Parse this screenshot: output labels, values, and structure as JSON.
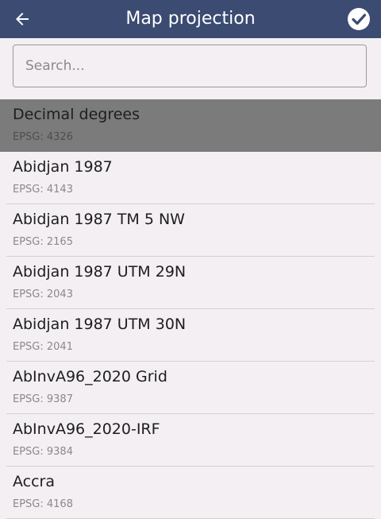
{
  "header": {
    "title": "Map projection",
    "bg_color": "#3b4b72",
    "back_icon": "arrow-left-icon",
    "confirm_icon": "check-circle-icon"
  },
  "search": {
    "placeholder": "Search...",
    "value": ""
  },
  "projections": [
    {
      "name": "Decimal degrees",
      "code": "EPSG: 4326",
      "selected": true
    },
    {
      "name": "Abidjan 1987",
      "code": "EPSG: 4143",
      "selected": false
    },
    {
      "name": "Abidjan 1987 TM 5 NW",
      "code": "EPSG: 2165",
      "selected": false
    },
    {
      "name": "Abidjan 1987 UTM 29N",
      "code": "EPSG: 2043",
      "selected": false
    },
    {
      "name": "Abidjan 1987 UTM 30N",
      "code": "EPSG: 2041",
      "selected": false
    },
    {
      "name": "AbInvA96_2020 Grid",
      "code": "EPSG: 9387",
      "selected": false
    },
    {
      "name": "AbInvA96_2020-IRF",
      "code": "EPSG: 9384",
      "selected": false
    },
    {
      "name": "Accra",
      "code": "EPSG: 4168",
      "selected": false
    }
  ],
  "colors": {
    "selected_row": "#7b7b7b",
    "background": "#f3eff3"
  }
}
